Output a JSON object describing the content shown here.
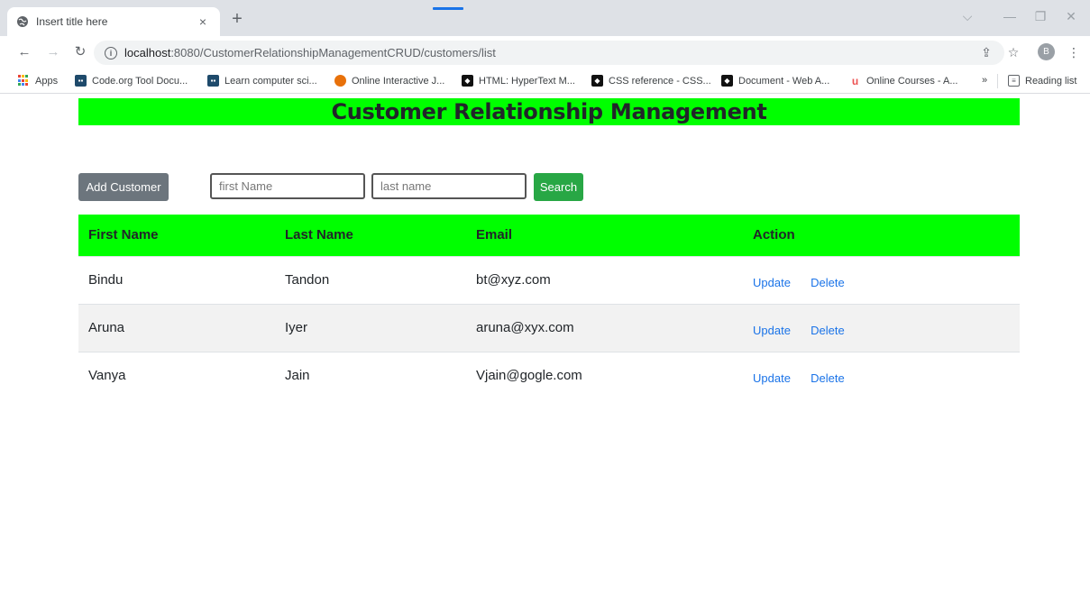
{
  "browser": {
    "tab_title": "Insert title here",
    "tab_close": "×",
    "new_tab": "+",
    "url_host": "localhost",
    "url_rest": ":8080/CustomerRelationshipManagementCRUD/customers/list",
    "avatar_initial": "B",
    "bookmarks": [
      {
        "label": "Apps"
      },
      {
        "label": "Code.org Tool Docu..."
      },
      {
        "label": "Learn computer sci..."
      },
      {
        "label": "Online Interactive J..."
      },
      {
        "label": "HTML: HyperText M..."
      },
      {
        "label": "CSS reference - CSS..."
      },
      {
        "label": "Document - Web A..."
      },
      {
        "label": "Online Courses - A..."
      }
    ],
    "more_bookmarks": "»",
    "reading_list": "Reading list"
  },
  "page": {
    "title": "Customer Relationship Management",
    "add_button": "Add Customer",
    "first_name_placeholder": "first Name",
    "last_name_placeholder": "last name",
    "search_button": "Search",
    "headers": {
      "first_name": "First Name",
      "last_name": "Last Name",
      "email": "Email",
      "action": "Action"
    },
    "customers": [
      {
        "first": "Bindu",
        "last": "Tandon",
        "email": "bt@xyz.com"
      },
      {
        "first": "Aruna",
        "last": "Iyer",
        "email": "aruna@xyx.com"
      },
      {
        "first": "Vanya",
        "last": "Jain",
        "email": "Vjain@gogle.com"
      }
    ],
    "update_label": "Update",
    "delete_label": "Delete"
  },
  "colors": {
    "header_green": "#00ff00",
    "add_button_gray": "#6c757d",
    "search_button_green": "#28a745",
    "link_blue": "#1a73e8"
  }
}
